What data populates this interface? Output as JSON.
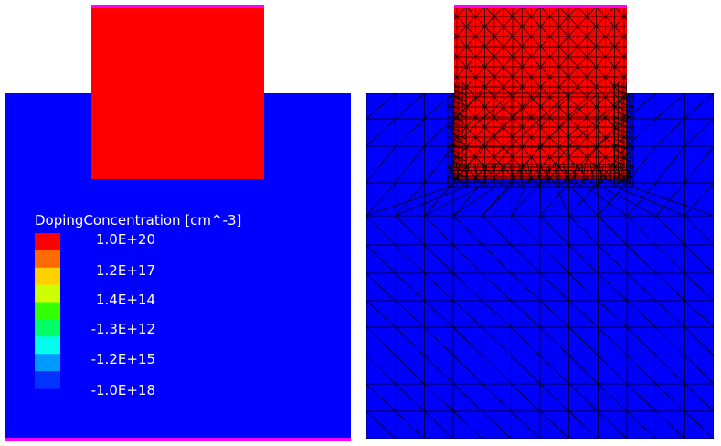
{
  "legend": {
    "title": "DopingConcentration [cm^-3]",
    "ticks": [
      "1.0E+20",
      "1.2E+17",
      "1.4E+14",
      "-1.3E+12",
      "-1.2E+15",
      "-1.0E+18"
    ]
  },
  "colors": {
    "n_region": "#ff0000",
    "p_region": "#0000ff",
    "contact": "#ff00ff",
    "mesh": "#000000",
    "colormap": [
      "#ff0000",
      "#ff6a00",
      "#ffd000",
      "#ccff00",
      "#33ff00",
      "#00ff66",
      "#00ffee",
      "#0099ff",
      "#0033ff"
    ]
  }
}
